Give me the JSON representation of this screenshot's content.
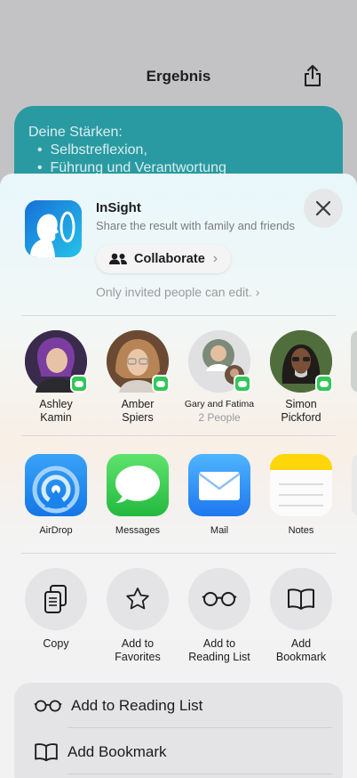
{
  "background": {
    "title": "Ergebnis",
    "card_heading": "Deine Stärken:",
    "card_items": [
      "Selbstreflexion,",
      "Führung und Verantwortung"
    ]
  },
  "sheet": {
    "app_name": "InSight",
    "app_subtitle": "Share the result with family and friends",
    "collaborate_label": "Collaborate",
    "invite_note": "Only invited people can edit.",
    "people": [
      {
        "name": "Ashley\nKamin",
        "sub": ""
      },
      {
        "name": "Amber\nSpiers",
        "sub": ""
      },
      {
        "name": "Gary and Fatima",
        "sub": "2 People"
      },
      {
        "name": "Simon\nPickford",
        "sub": ""
      }
    ],
    "apps": [
      {
        "label": "AirDrop",
        "icon": "airdrop-icon"
      },
      {
        "label": "Messages",
        "icon": "messages-icon"
      },
      {
        "label": "Mail",
        "icon": "mail-icon"
      },
      {
        "label": "Notes",
        "icon": "notes-icon"
      }
    ],
    "actions": [
      {
        "label": "Copy",
        "icon": "copy-icon"
      },
      {
        "label": "Add to\nFavorites",
        "icon": "star-icon"
      },
      {
        "label": "Add to\nReading List",
        "icon": "glasses-icon"
      },
      {
        "label": "Add\nBookmark",
        "icon": "book-icon"
      }
    ],
    "list": [
      {
        "label": "Add to Reading List",
        "icon": "glasses-icon"
      },
      {
        "label": "Add Bookmark",
        "icon": "book-icon"
      }
    ]
  },
  "colors": {
    "accent_teal": "#2a9aa2",
    "messages_green": "#32c759",
    "airdrop_blue": "#1a8cf0",
    "mail_blue": "#2b8cf3",
    "notes_yellow": "#ffd60a"
  }
}
